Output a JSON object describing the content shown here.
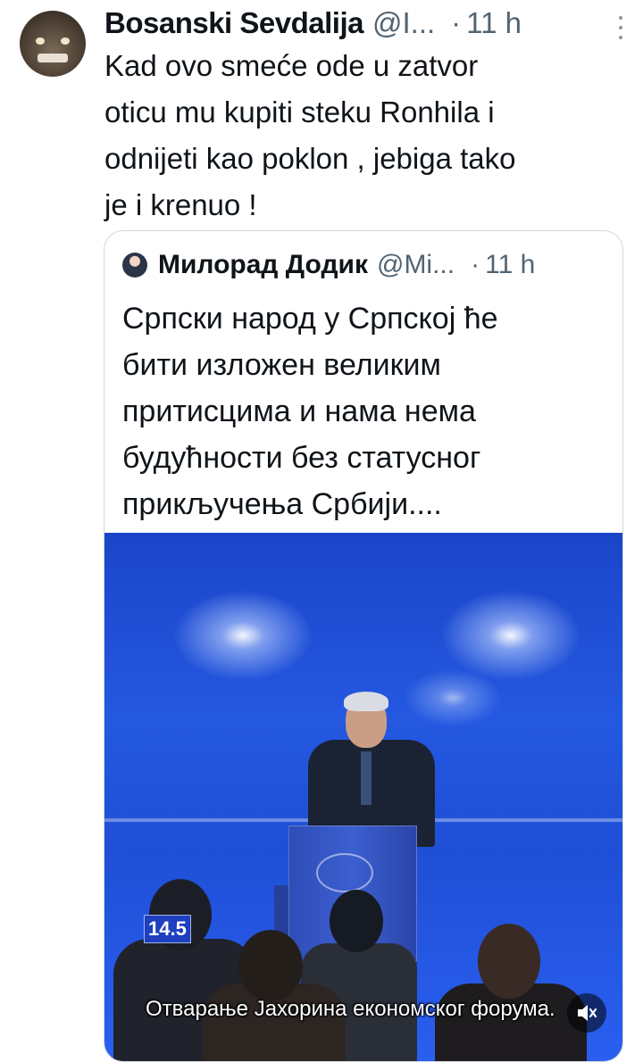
{
  "tweet": {
    "display_name": "Bosanski Sevdalija",
    "handle": "@I...",
    "dot": "·",
    "time": "11 h",
    "text": "Kad ovo smeće ode u zatvor\noticu mu kupiti steku Ronhila i\nodnijeti kao poklon , jebiga tako\nje i krenuo !",
    "more_icon": "more-vertical-icon"
  },
  "quoted_tweet": {
    "display_name": "Милорад Додик",
    "handle": "@Mi...",
    "dot": "·",
    "time": "11 h",
    "text": "Српски народ у Српској ће\nбити изложен великим\nпритисцима и нама нема\nбудућности без статусног\nприкључења Србији....",
    "video": {
      "channel_badge": "14.5",
      "subtitle": "Отварање Јахорина економског форума.",
      "mute_icon": "volume-muted-icon"
    }
  },
  "colors": {
    "text_primary": "#0f1419",
    "text_secondary": "#536471",
    "border": "#cfd9de",
    "video_blue": "#1f4fd6"
  }
}
